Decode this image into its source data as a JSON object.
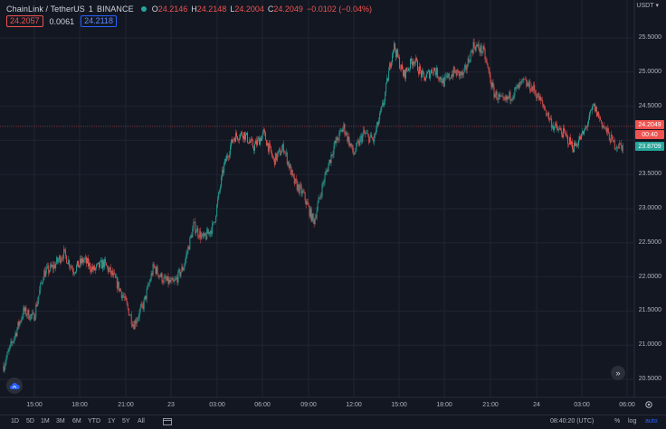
{
  "legend": {
    "title": "ChainLink / TetherUS",
    "interval": "1",
    "exchange": "BINANCE",
    "open_key": "O",
    "open": "24.2146",
    "high_key": "H",
    "high": "24.2148",
    "low_key": "L",
    "low": "24.2004",
    "close_key": "C",
    "close": "24.2049",
    "change": "−0.0102 (−0.04%)",
    "status_color": "#26a69a"
  },
  "badges": {
    "sell": "24.2057",
    "spread": "0.0061",
    "buy": "24.2118"
  },
  "axis": {
    "currency": "USDT",
    "price_labels": [
      "25.5000",
      "25.0000",
      "24.5000",
      "23.5000",
      "23.0000",
      "22.5000",
      "22.0000",
      "21.5000",
      "21.0000",
      "20.5000"
    ],
    "time_labels": [
      "15:00",
      "18:00",
      "21:00",
      "23",
      "03:00",
      "06:00",
      "09:00",
      "12:00",
      "15:00",
      "18:00",
      "21:00",
      "24",
      "03:00",
      "06:00"
    ]
  },
  "price_tags": {
    "last": "24.2049",
    "countdown": "00:40",
    "low_marker": "23.8709",
    "up_color": "#26a69a",
    "down_color": "#ef5350"
  },
  "bottom_bar": {
    "ranges": [
      "1D",
      "5D",
      "1M",
      "3M",
      "6M",
      "YTD",
      "1Y",
      "5Y",
      "All"
    ],
    "clock": "08:40:20 (UTC)",
    "percent": "%",
    "log": "log",
    "auto": "auto"
  },
  "chart_data": {
    "type": "candlestick",
    "title": "",
    "xlabel": "",
    "ylabel": "",
    "ylim": [
      20.3,
      25.7
    ],
    "grid": true,
    "x": [
      "15:00",
      "18:00",
      "21:00",
      "23",
      "03:00",
      "06:00",
      "09:00",
      "12:00",
      "15:00",
      "18:00",
      "21:00",
      "24",
      "03:00",
      "06:00"
    ],
    "close_path": [
      [
        0.0,
        20.7
      ],
      [
        1.0,
        21.5
      ],
      [
        1.5,
        21.4
      ],
      [
        2.0,
        22.05
      ],
      [
        2.5,
        22.15
      ],
      [
        3.0,
        22.35
      ],
      [
        3.5,
        22.1
      ],
      [
        4.0,
        22.25
      ],
      [
        4.5,
        22.1
      ],
      [
        5.0,
        22.2
      ],
      [
        5.5,
        22.0
      ],
      [
        6.0,
        21.7
      ],
      [
        6.5,
        21.3
      ],
      [
        7.0,
        21.6
      ],
      [
        7.5,
        22.15
      ],
      [
        8.0,
        21.95
      ],
      [
        8.5,
        21.9
      ],
      [
        9.0,
        22.15
      ],
      [
        9.5,
        22.75
      ],
      [
        10.0,
        22.55
      ],
      [
        10.5,
        22.75
      ],
      [
        11.0,
        23.6
      ],
      [
        11.5,
        24.05
      ],
      [
        12.0,
        24.1
      ],
      [
        12.5,
        23.9
      ],
      [
        13.0,
        24.1
      ],
      [
        13.5,
        23.7
      ],
      [
        14.0,
        23.9
      ],
      [
        14.5,
        23.4
      ],
      [
        15.0,
        23.2
      ],
      [
        15.5,
        22.8
      ],
      [
        16.0,
        23.4
      ],
      [
        16.5,
        23.9
      ],
      [
        17.0,
        24.2
      ],
      [
        17.5,
        23.8
      ],
      [
        18.0,
        24.1
      ],
      [
        18.5,
        24.0
      ],
      [
        19.0,
        24.55
      ],
      [
        19.5,
        25.4
      ],
      [
        20.0,
        24.95
      ],
      [
        20.5,
        25.2
      ],
      [
        21.0,
        24.9
      ],
      [
        21.5,
        25.05
      ],
      [
        22.0,
        24.85
      ],
      [
        22.5,
        25.0
      ],
      [
        23.0,
        24.95
      ],
      [
        23.5,
        25.4
      ],
      [
        24.0,
        25.3
      ],
      [
        24.5,
        24.7
      ],
      [
        25.0,
        24.55
      ],
      [
        25.5,
        24.7
      ],
      [
        26.0,
        24.85
      ],
      [
        26.5,
        24.75
      ],
      [
        27.0,
        24.5
      ],
      [
        27.5,
        24.2
      ],
      [
        28.0,
        24.1
      ],
      [
        28.5,
        23.9
      ],
      [
        29.0,
        24.1
      ],
      [
        29.5,
        24.5
      ],
      [
        30.0,
        24.2
      ],
      [
        30.5,
        23.95
      ],
      [
        31.0,
        23.9
      ]
    ],
    "x_unit": "half-hours since first label minus 1h, 15:00 = 1.0"
  }
}
